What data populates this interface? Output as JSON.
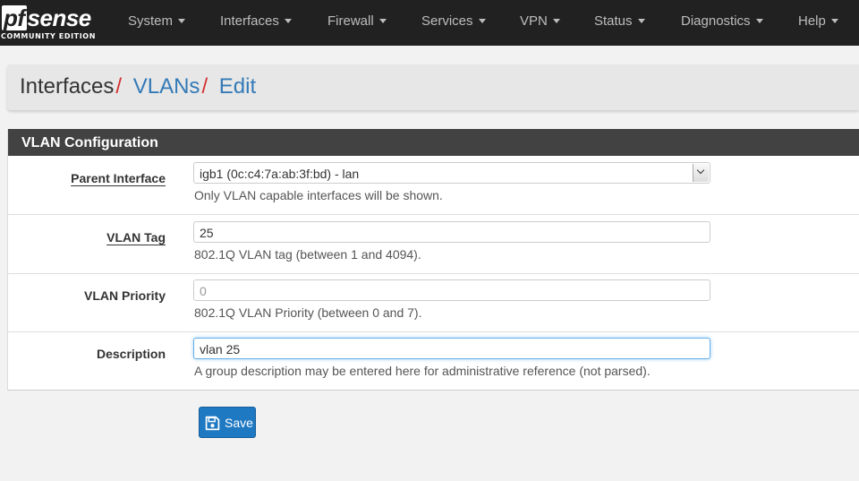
{
  "brand": {
    "name": "sense",
    "name_prefix": "pf",
    "edition": "COMMUNITY EDITION"
  },
  "nav": {
    "items": [
      {
        "label": "System"
      },
      {
        "label": "Interfaces"
      },
      {
        "label": "Firewall"
      },
      {
        "label": "Services"
      },
      {
        "label": "VPN"
      },
      {
        "label": "Status"
      },
      {
        "label": "Diagnostics"
      },
      {
        "label": "Help"
      }
    ]
  },
  "breadcrumb": {
    "items": [
      {
        "label": "Interfaces",
        "separator": "/"
      },
      {
        "label": "VLANs",
        "separator": "/"
      },
      {
        "label": "Edit"
      }
    ]
  },
  "panel": {
    "title": "VLAN Configuration",
    "fields": [
      {
        "label": "Parent Interface",
        "value": "igb1 (0c:c4:7a:ab:3f:bd) - lan",
        "help": "Only VLAN capable interfaces will be shown."
      },
      {
        "label": "VLAN Tag",
        "value": "25",
        "help": "802.1Q VLAN tag (between 1 and 4094)."
      },
      {
        "label": "VLAN Priority",
        "value": "0",
        "help": "802.1Q VLAN Priority (between 0 and 7)."
      },
      {
        "label": "Description",
        "value": "vlan 25",
        "help": "A group description may be entered here for administrative reference (not parsed)."
      }
    ]
  },
  "actions": {
    "save_label": "Save",
    "save_icon": "save-icon"
  },
  "colors": {
    "navbar": "#212121",
    "panel_heading": "#424242",
    "link": "#337ab7",
    "breadcrumb_separator": "#d32f2f",
    "primary_button": "#1e78c2"
  }
}
